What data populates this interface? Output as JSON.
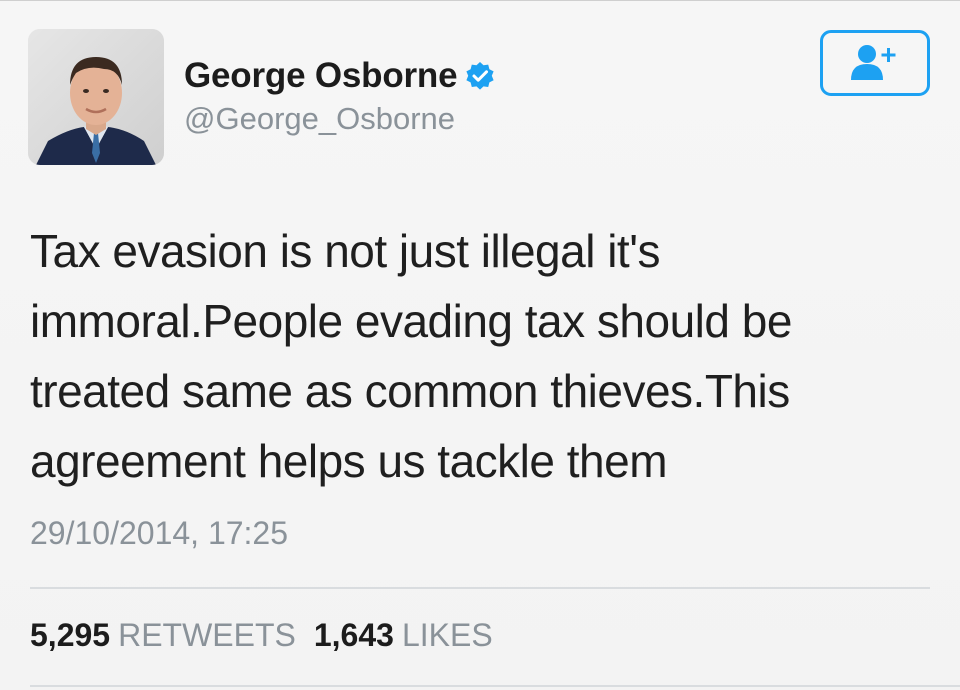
{
  "tweet": {
    "author": {
      "display_name": "George Osborne",
      "handle": "@George_Osborne",
      "verified": true,
      "avatar_icon": "profile-photo"
    },
    "follow_button": {
      "icon": "add-user-icon"
    },
    "text": "Tax evasion is not just illegal it's immoral.People evading tax should be treated same as common thieves.This agreement helps us tackle them",
    "timestamp": "29/10/2014, 17:25",
    "stats": {
      "retweets_count": "5,295",
      "retweets_label": "RETWEETS",
      "likes_count": "1,643",
      "likes_label": "LIKES"
    }
  },
  "colors": {
    "accent": "#1da1f2",
    "text_primary": "#1f1f1f",
    "text_secondary": "#8a9299",
    "background": "#f4f4f4"
  }
}
